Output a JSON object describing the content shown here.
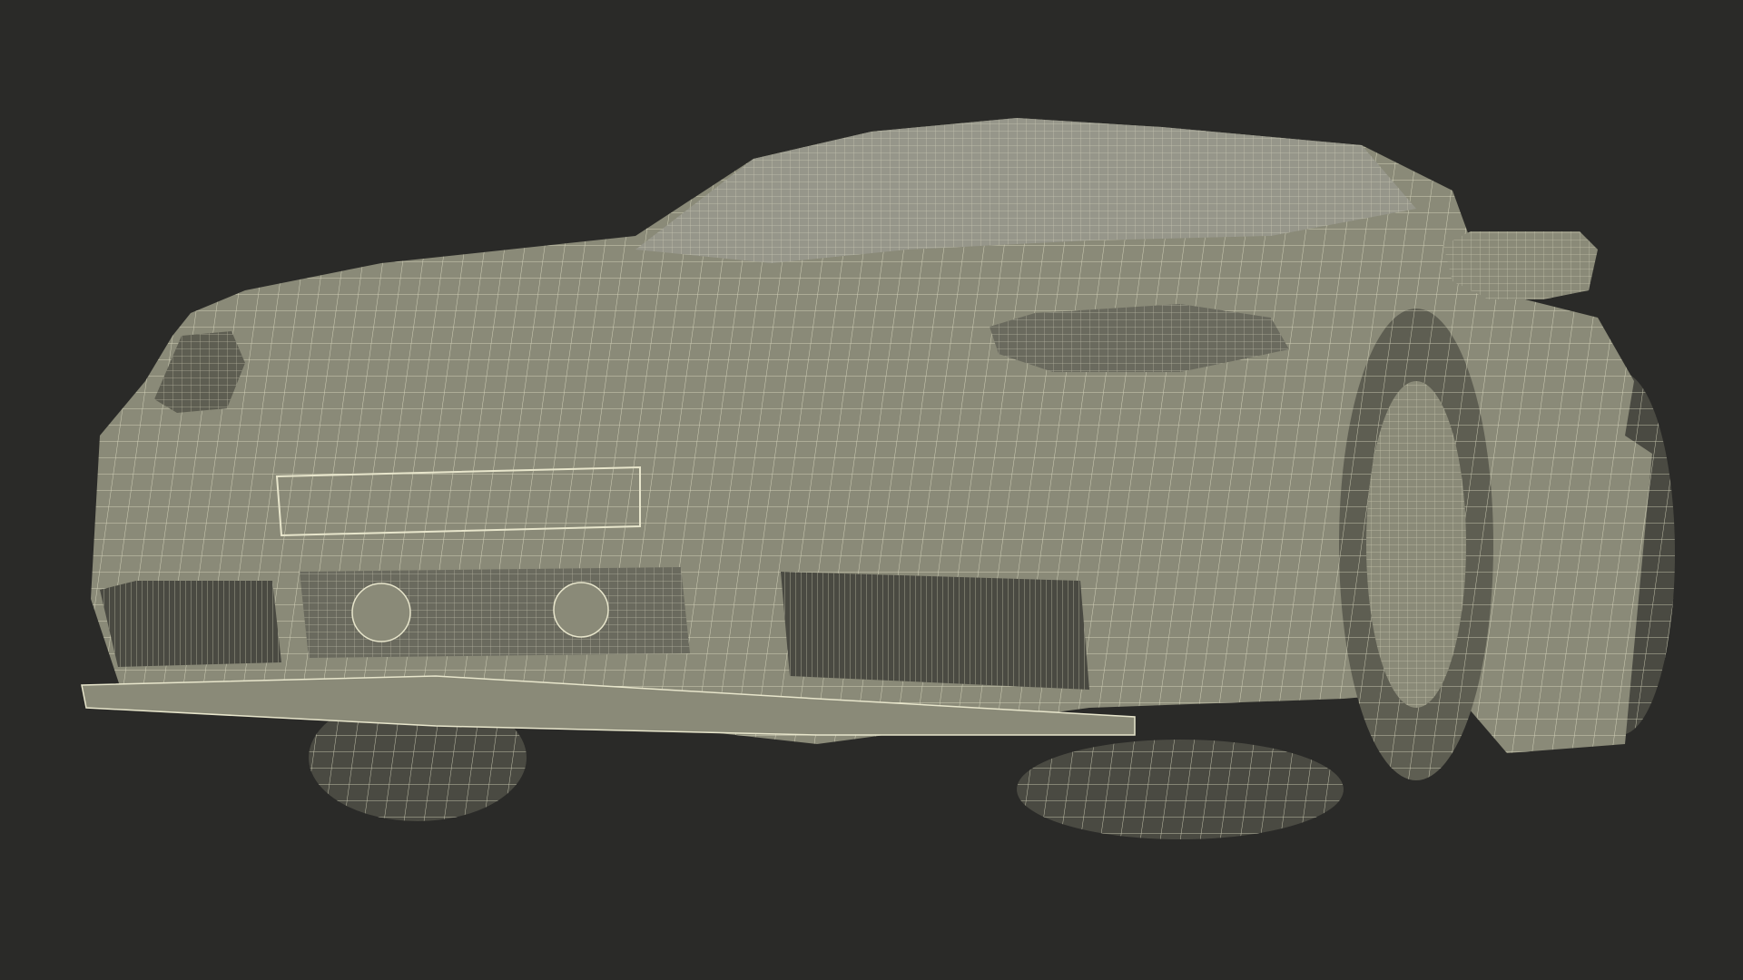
{
  "scene": {
    "subject": "wireframe-sports-car",
    "view": "front-three-quarter-low",
    "colors": {
      "background": "#2a2a28",
      "body": "#8a8a78",
      "body_dark": "#5e5e52",
      "body_shadow": "#4a4a42",
      "wire": "#e8e6cc"
    }
  }
}
